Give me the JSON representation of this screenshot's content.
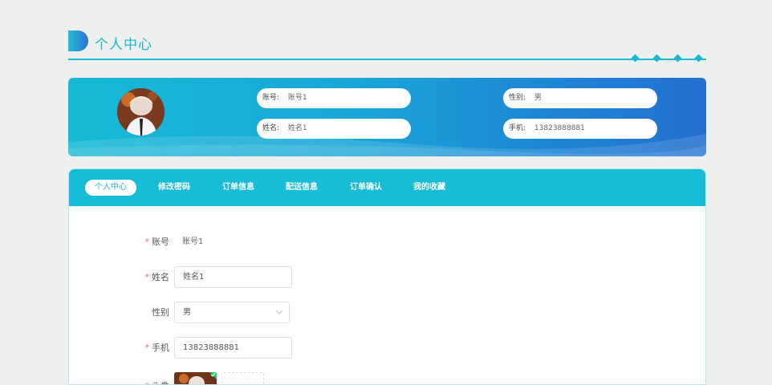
{
  "header": {
    "title": "个人中心"
  },
  "profile": {
    "account_label": "账号:",
    "account_value": "账号1",
    "name_label": "姓名:",
    "name_value": "姓名1",
    "gender_label": "性别:",
    "gender_value": "男",
    "phone_label": "手机:",
    "phone_value": "13823888881"
  },
  "tabs": [
    {
      "label": "个人中心",
      "active": true
    },
    {
      "label": "修改密码"
    },
    {
      "label": "订单信息"
    },
    {
      "label": "配送信息"
    },
    {
      "label": "订单确认"
    },
    {
      "label": "我的收藏"
    }
  ],
  "form": {
    "account_label": "账号",
    "account_value": "账号1",
    "name_label": "姓名",
    "name_value": "姓名1",
    "gender_label": "性别",
    "gender_value": "男",
    "phone_label": "手机",
    "phone_value": "13823888881",
    "avatar_label": "头像"
  },
  "colors": {
    "accent": "#17bcd6",
    "banner_end": "#2470d0",
    "required": "#f56c6c"
  },
  "icons": [
    "logo-mark-icon",
    "diamond-icon",
    "chevron-down-icon",
    "check-icon"
  ]
}
